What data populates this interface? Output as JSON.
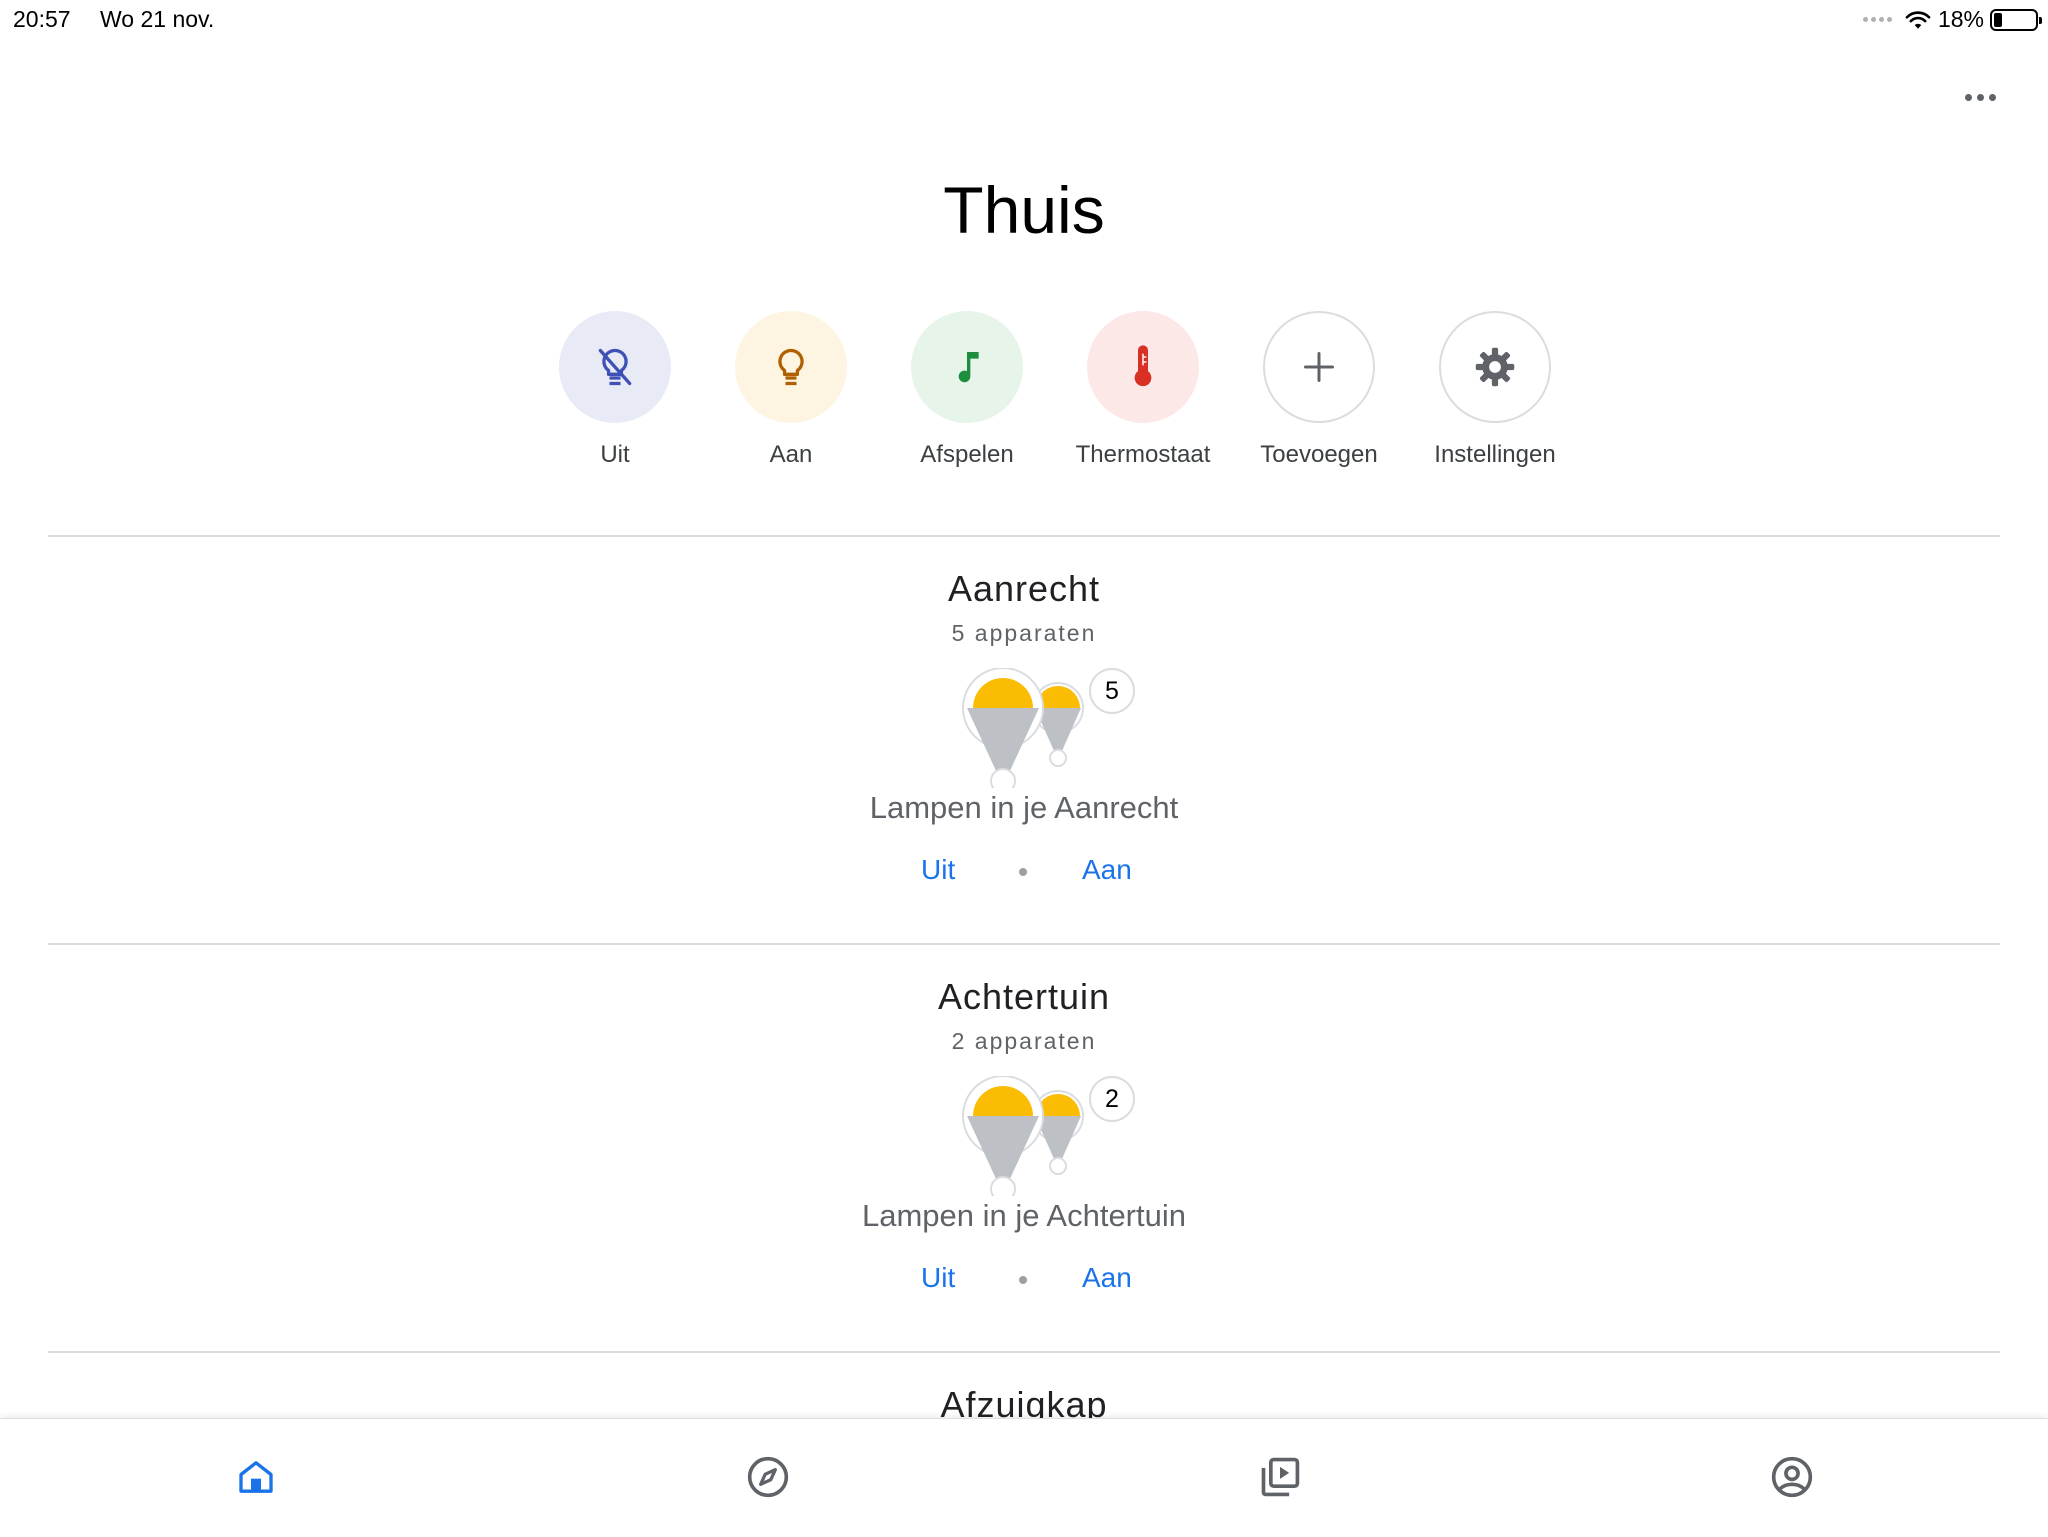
{
  "status_bar": {
    "time": "20:57",
    "date": "Wo 21 nov.",
    "battery": "18%"
  },
  "home": {
    "title": "Thuis"
  },
  "quick_actions": [
    {
      "label": "Uit",
      "icon": "lightbulb-off-icon",
      "bg": "#e8eaf6",
      "color": "#3f51b5"
    },
    {
      "label": "Aan",
      "icon": "lightbulb-icon",
      "bg": "#fdf5e1",
      "color": "#b06000"
    },
    {
      "label": "Afspelen",
      "icon": "music-note-icon",
      "bg": "#e6f4ea",
      "color": "#1e8e3e"
    },
    {
      "label": "Thermostaat",
      "icon": "thermometer-icon",
      "bg": "#fce8e6",
      "color": "#d93025"
    },
    {
      "label": "Toevoegen",
      "icon": "plus-icon"
    },
    {
      "label": "Instellingen",
      "icon": "gear-icon"
    }
  ],
  "rooms": [
    {
      "name": "Aanrecht",
      "count": "5 apparaten",
      "badge": "5",
      "description": "Lampen in je Aanrecht",
      "off_label": "Uit",
      "on_label": "Aan"
    },
    {
      "name": "Achtertuin",
      "count": "2 apparaten",
      "badge": "2",
      "description": "Lampen in je Achtertuin",
      "off_label": "Uit",
      "on_label": "Aan"
    },
    {
      "name": "Afzuigkap"
    }
  ],
  "colors": {
    "accent": "#1a73e8",
    "bulb_yellow": "#fbbc04",
    "bulb_grey": "#bdc1c6"
  },
  "bottom_nav": [
    "home-icon",
    "explore-icon",
    "media-icon",
    "account-icon"
  ]
}
